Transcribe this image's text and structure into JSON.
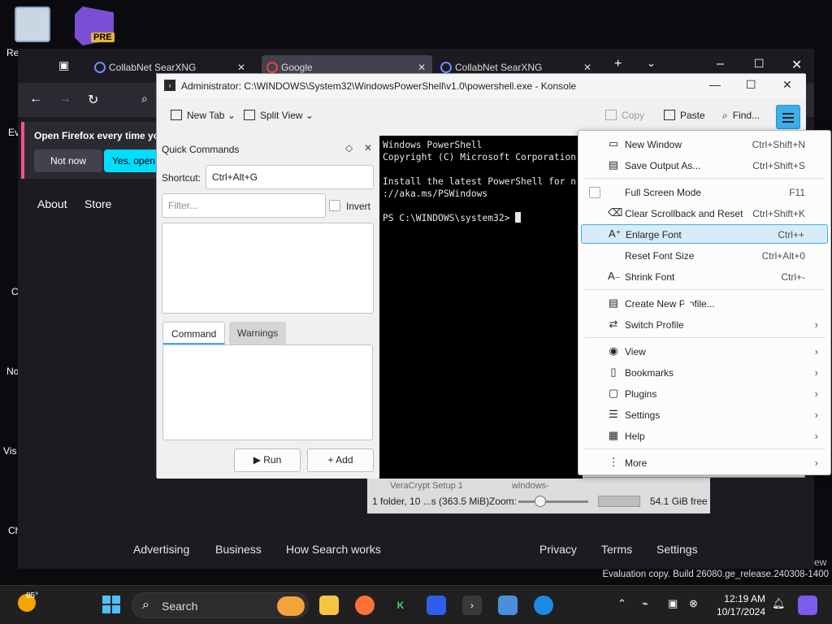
{
  "desktop": {
    "labels": [
      "Re",
      "Ev",
      "C",
      "No",
      "Vis",
      "Ch"
    ]
  },
  "vs_badge": "PRE",
  "firefox": {
    "tabs": [
      {
        "label": "CollabNet SearXNG"
      },
      {
        "label": "Google"
      },
      {
        "label": "CollabNet SearXNG"
      }
    ],
    "notice": {
      "title": "Open Firefox every time yo",
      "not_now": "Not now",
      "yes": "Yes, open F"
    },
    "links": {
      "about": "About",
      "store": "Store"
    },
    "footer": [
      "Advertising",
      "Business",
      "How Search works",
      "Privacy",
      "Terms",
      "Settings"
    ],
    "ew": "ew"
  },
  "dolphin": {
    "file1": "VeraCrypt Setup 1",
    "file2": "windows-",
    "info": "1 folder, 10 ...s (363.5 MiB)",
    "zoom_label": "Zoom:",
    "free": "54.1 GiB free"
  },
  "konsole": {
    "title": "Administrator: C:\\WINDOWS\\System32\\WindowsPowerShell\\v1.0\\powershell.exe - Konsole",
    "toolbar": {
      "new_tab": "New Tab",
      "split_view": "Split View",
      "copy": "Copy",
      "paste": "Paste",
      "find": "Find..."
    },
    "quick_commands": {
      "title": "Quick Commands",
      "shortcut_label": "Shortcut:",
      "shortcut_value": "Ctrl+Alt+G",
      "filter_placeholder": "Filter...",
      "invert": "Invert",
      "tab_command": "Command",
      "tab_warnings": "Warnings",
      "run": "Run",
      "add": "Add"
    },
    "terminal": {
      "line1": "Windows PowerShell",
      "line2": "Copyright (C) Microsoft Corporation",
      "line3": "Install the latest PowerShell for n",
      "line4": "://aka.ms/PSWindows",
      "prompt": "PS C:\\WINDOWS\\system32> "
    },
    "menu": {
      "items": [
        {
          "label": "New Window",
          "shortcut": "Ctrl+Shift+N",
          "icon": "new-window-icon"
        },
        {
          "label": "Save Output As...",
          "shortcut": "Ctrl+Shift+S",
          "icon": "save-icon"
        },
        {
          "label": "Full Screen Mode",
          "shortcut": "F11",
          "icon": "checkbox"
        },
        {
          "label": "Clear Scrollback and Reset",
          "shortcut": "Ctrl+Shift+K",
          "icon": "clear-icon"
        },
        {
          "label": "Enlarge Font",
          "shortcut": "Ctrl++",
          "icon": "enlarge-font-icon"
        },
        {
          "label": "Reset Font Size",
          "shortcut": "Ctrl+Alt+0",
          "icon": ""
        },
        {
          "label": "Shrink Font",
          "shortcut": "Ctrl+-",
          "icon": "shrink-font-icon"
        },
        {
          "label": "Create New Profile...",
          "shortcut": "",
          "icon": "profile-icon"
        },
        {
          "label": "Switch Profile",
          "shortcut": "",
          "icon": "switch-icon"
        },
        {
          "label": "View",
          "shortcut": "",
          "icon": "eye-icon"
        },
        {
          "label": "Bookmarks",
          "shortcut": "",
          "icon": "bookmark-icon"
        },
        {
          "label": "Plugins",
          "shortcut": "",
          "icon": "plugin-icon"
        },
        {
          "label": "Settings",
          "shortcut": "",
          "icon": "settings-icon"
        },
        {
          "label": "Help",
          "shortcut": "",
          "icon": "help-icon"
        },
        {
          "label": "More",
          "shortcut": "",
          "icon": "more-icon"
        }
      ]
    }
  },
  "evaluation": {
    "line1": "Evaluation copy. Build 26080.ge_release.240308-1400"
  },
  "taskbar": {
    "temp": "85°",
    "search": "Search",
    "time": "12:19 AM",
    "date": "10/17/2024"
  },
  "colors": {
    "accent": "#3daee9",
    "firefox_bg": "#1c1b22",
    "taskbar": "#202020"
  }
}
